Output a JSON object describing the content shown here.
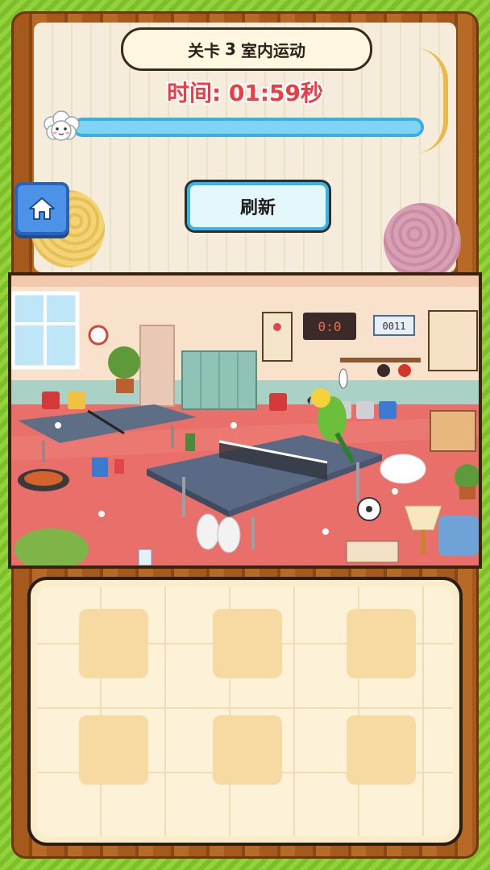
{
  "header": {
    "level_prefix": "关卡",
    "level_number": "3",
    "level_name": "室内运动"
  },
  "timer": {
    "text": "时间: 01:59秒"
  },
  "progress": {
    "fraction": 1.0
  },
  "buttons": {
    "refresh_label": "刷新"
  },
  "scene": {
    "scoreboard": "0:0",
    "counter": "0011"
  },
  "tray": {
    "slot_count": 6
  },
  "colors": {
    "timer": "#ee3c43",
    "progress_border": "#3aaee0",
    "home_button": "#4c93e8"
  }
}
